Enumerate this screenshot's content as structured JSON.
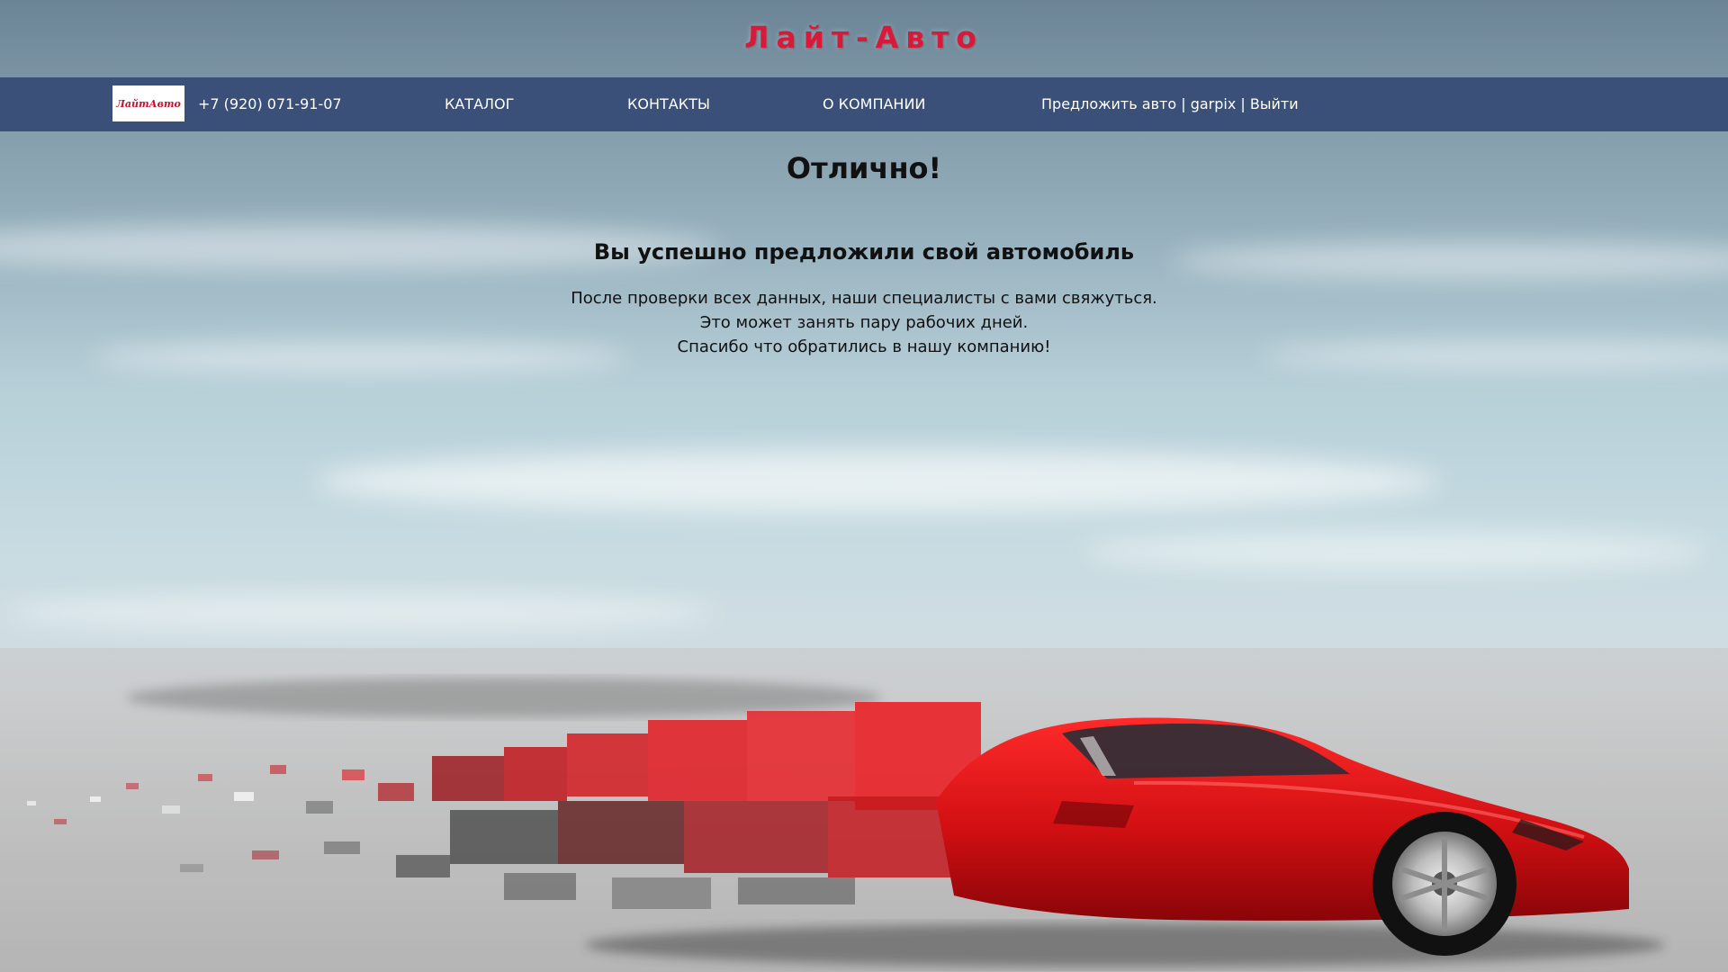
{
  "site": {
    "title": "Лайт-Авто",
    "logo_text": "ЛайтАвто"
  },
  "nav": {
    "phone": "+7 (920) 071-91-07",
    "links": [
      "КАТАЛОГ",
      "КОНТАКТЫ",
      "О КОМПАНИИ"
    ],
    "user_actions": {
      "offer_car": "Предложить авто",
      "username": "garpix",
      "logout": "Выйти",
      "separator": "|"
    }
  },
  "main": {
    "heading": "Отлично!",
    "subheading": "Вы успешно предложили свой автомобиль",
    "lines": [
      "После проверки всех данных, наши специалисты с вами свяжуться.",
      "Это может занять пару рабочих дней.",
      "Спасибо что обратились в нашу компанию!"
    ]
  },
  "colors": {
    "brand_red": "#d81a3a",
    "nav_bg": "#3a5079"
  },
  "icons": {
    "background_image": "red-sports-car-disintegrating"
  }
}
